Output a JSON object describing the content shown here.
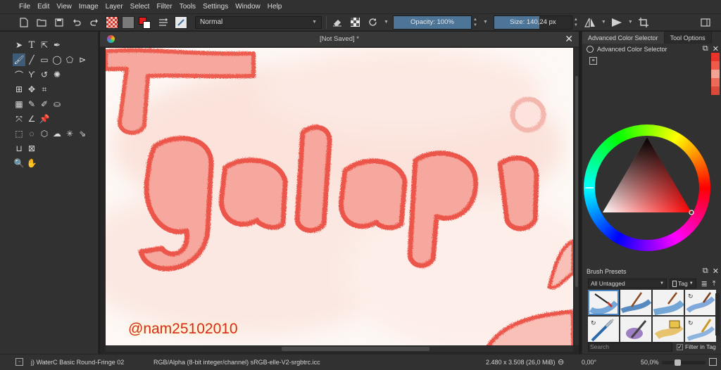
{
  "menu": [
    {
      "label": "File"
    },
    {
      "label": "Edit"
    },
    {
      "label": "View"
    },
    {
      "label": "Image"
    },
    {
      "label": "Layer"
    },
    {
      "label": "Select"
    },
    {
      "label": "Filter"
    },
    {
      "label": "Tools"
    },
    {
      "label": "Settings"
    },
    {
      "label": "Window"
    },
    {
      "label": "Help"
    }
  ],
  "toolbar": {
    "blend_mode": "Normal",
    "opacity_label": "Opacity: 100%",
    "opacity_value": 1.0,
    "size_label": "Size: 140,24 px",
    "size_fraction": 0.58,
    "fg_color": "#e02020",
    "bg_color": "#ffffff"
  },
  "document": {
    "tab_title": "[Not Saved]  *",
    "canvas_text": "galapi",
    "watermark": "@nam25102010"
  },
  "docker": {
    "tabs": [
      "Advanced Color Selector",
      "Tool Options"
    ],
    "panel_title": "Advanced Color Selector",
    "recent_colors": [
      "#e8322a",
      "#f05a4a",
      "#f4a294",
      "#ec6a56",
      "#d94a3a"
    ],
    "brush_presets_title": "Brush Presets",
    "tag_filter": "All Untagged",
    "tag_button": "Tag",
    "search_placeholder": "Search",
    "filter_in_tag": "Filter in Tag"
  },
  "status": {
    "brush_name": "j) WaterC Basic Round-Fringe 02",
    "color_space": "RGB/Alpha (8-bit integer/channel)  sRGB-elle-V2-srgbtrc.icc",
    "dimensions": "2.480 x 3.508 (26,0 MiB)",
    "rotation": "0,00°",
    "zoom": "50,0%"
  },
  "colors": {
    "accent": "#4d7597",
    "brush_red": "#e8362c"
  }
}
